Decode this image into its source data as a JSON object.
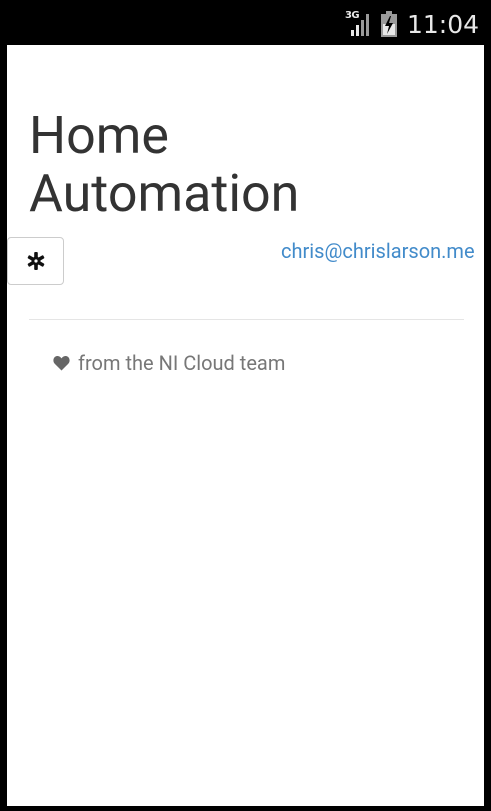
{
  "status_bar": {
    "network_type": "3G",
    "time": "11:04",
    "icons": [
      "signal-icon",
      "battery-charging-icon"
    ]
  },
  "page": {
    "title": "Home Automation",
    "settings_button_icon": "gear-icon",
    "user_email": "chris@chrislarson.me",
    "footer": {
      "icon": "heart-icon",
      "text": "from the NI Cloud team"
    }
  },
  "colors": {
    "link": "#428bca",
    "title_text": "#333333",
    "muted_text": "#777777",
    "divider": "#e5e5e5",
    "status_bar_bg": "#000000"
  }
}
